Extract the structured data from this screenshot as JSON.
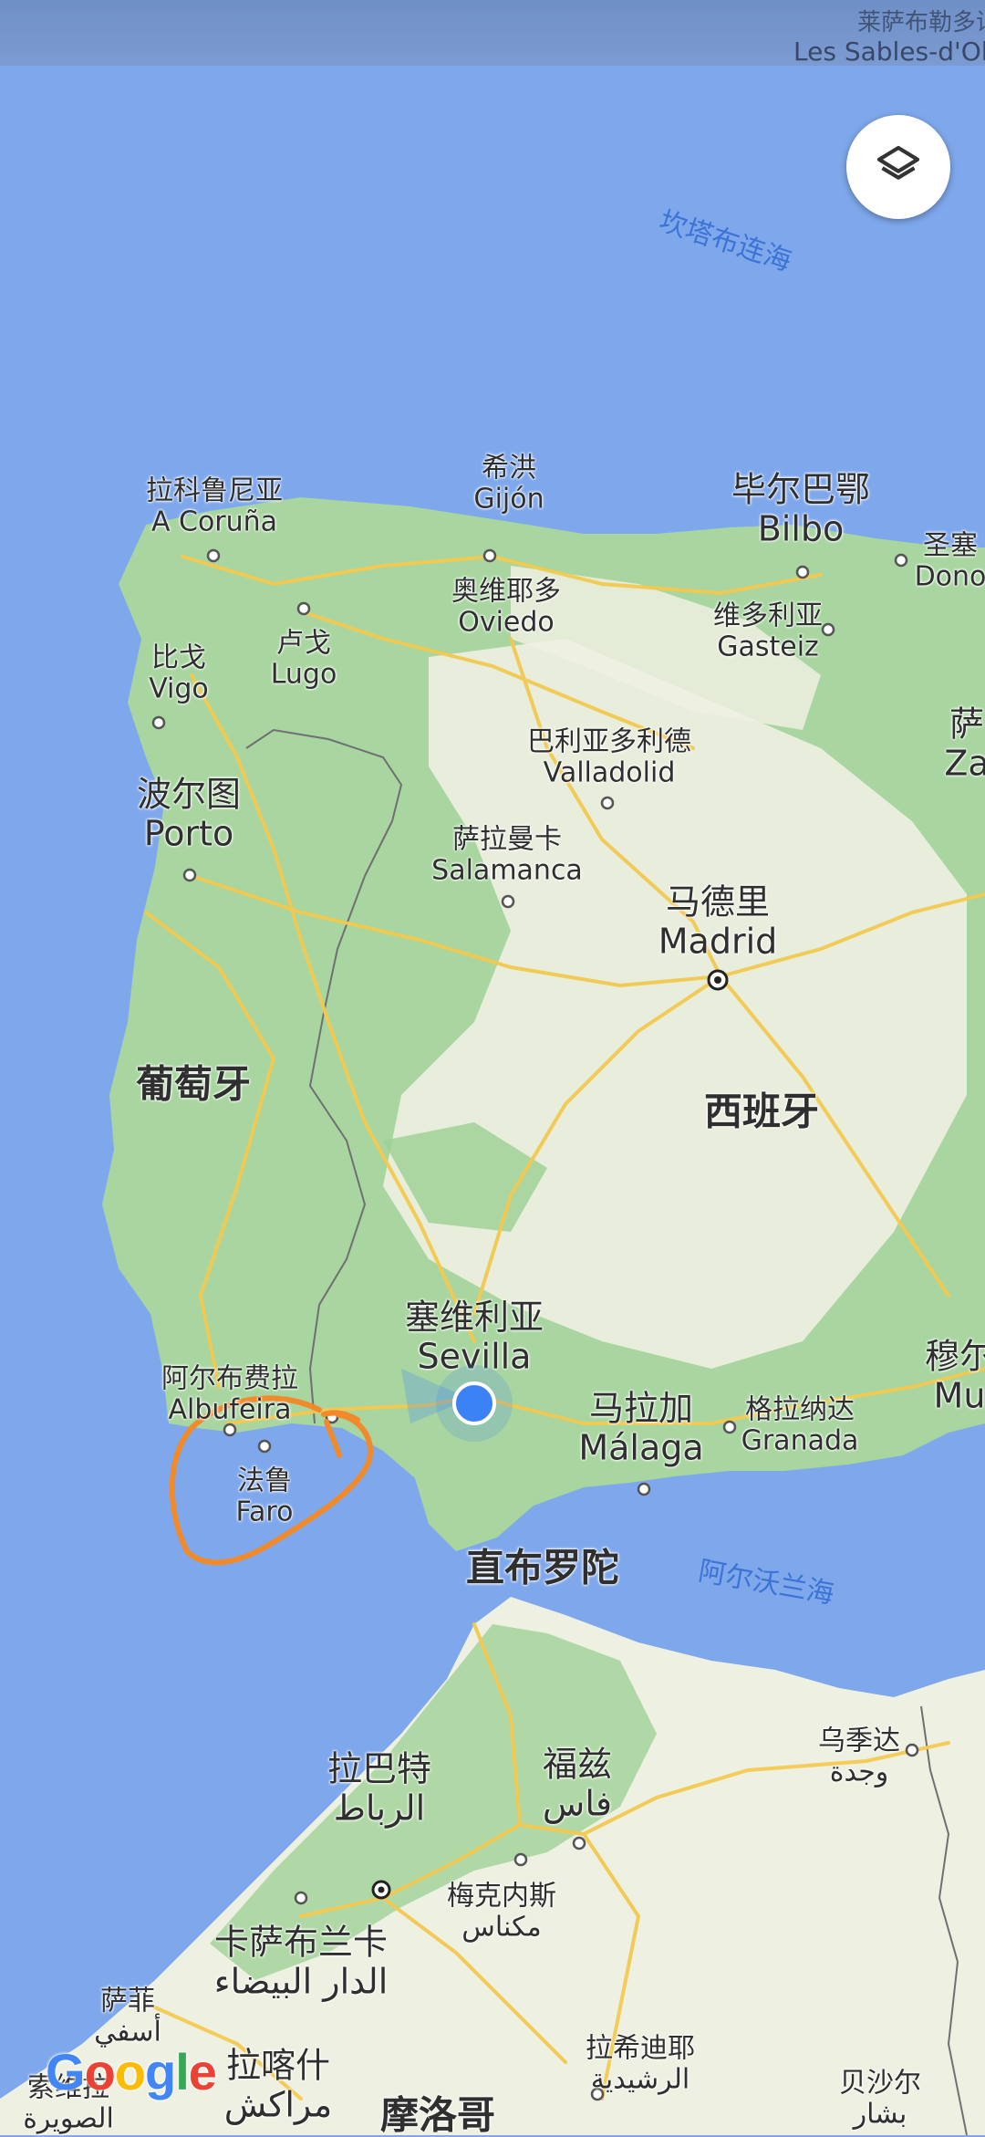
{
  "status_bar": {
    "partial_label": "Les Sables-d'Olo",
    "partial_label_zh": "莱萨布勒多讷"
  },
  "map": {
    "provider": "Google",
    "colors": {
      "sea": "#7fa8ec",
      "land": "#a8d5a0",
      "land_arid": "#f1efe4",
      "road": "#f3c94f",
      "annotation": "#f08a2a",
      "location": "#3b82f6"
    },
    "seas": [
      {
        "id": "cantabrian",
        "name": "坎塔布连海"
      },
      {
        "id": "alboran",
        "name": "阿尔沃兰海"
      }
    ],
    "countries": [
      {
        "id": "portugal",
        "name": "葡萄牙"
      },
      {
        "id": "spain",
        "name": "西班牙"
      },
      {
        "id": "morocco",
        "name": "摩洛哥"
      }
    ],
    "cities": [
      {
        "id": "coruna",
        "zh": "拉科鲁尼亚",
        "local": "A Coruña"
      },
      {
        "id": "gijon",
        "zh": "希洪",
        "local": "Gijón"
      },
      {
        "id": "bilbo",
        "zh": "毕尔巴鄂",
        "local": "Bilbo"
      },
      {
        "id": "donostia",
        "zh": "圣塞",
        "local": "Dono"
      },
      {
        "id": "oviedo",
        "zh": "奥维耶多",
        "local": "Oviedo"
      },
      {
        "id": "gasteiz",
        "zh": "维多利亚",
        "local": "Gasteiz"
      },
      {
        "id": "lugo",
        "zh": "卢戈",
        "local": "Lugo"
      },
      {
        "id": "vigo",
        "zh": "比戈",
        "local": "Vigo"
      },
      {
        "id": "zaragoza",
        "zh": "萨",
        "local": "Za"
      },
      {
        "id": "valladolid",
        "zh": "巴利亚多利德",
        "local": "Valladolid"
      },
      {
        "id": "porto",
        "zh": "波尔图",
        "local": "Porto"
      },
      {
        "id": "salamanca",
        "zh": "萨拉曼卡",
        "local": "Salamanca"
      },
      {
        "id": "madrid",
        "zh": "马德里",
        "local": "Madrid"
      },
      {
        "id": "sevilla",
        "zh": "塞维利亚",
        "local": "Sevilla"
      },
      {
        "id": "murcia",
        "zh": "穆尔",
        "local": "Mu"
      },
      {
        "id": "albufeira",
        "zh": "阿尔布费拉",
        "local": "Albufeira"
      },
      {
        "id": "malaga",
        "zh": "马拉加",
        "local": "Málaga"
      },
      {
        "id": "granada",
        "zh": "格拉纳达",
        "local": "Granada"
      },
      {
        "id": "faro",
        "zh": "法鲁",
        "local": "Faro"
      },
      {
        "id": "gibraltar",
        "zh": "直布罗陀",
        "local": ""
      },
      {
        "id": "oujda",
        "zh": "乌季达",
        "local": "وجدة"
      },
      {
        "id": "rabat",
        "zh": "拉巴特",
        "local": "الرباط"
      },
      {
        "id": "fes",
        "zh": "福兹",
        "local": "فاس"
      },
      {
        "id": "meknes",
        "zh": "梅克内斯",
        "local": "مكناس"
      },
      {
        "id": "casablanca",
        "zh": "卡萨布兰卡",
        "local": "الدار البيضاء"
      },
      {
        "id": "safi",
        "zh": "萨菲",
        "local": "أسفي"
      },
      {
        "id": "marrakesh",
        "zh": "拉喀什",
        "local": "مراكش"
      },
      {
        "id": "errachidia",
        "zh": "拉希迪耶",
        "local": "الرشيدية"
      },
      {
        "id": "bechar",
        "zh": "贝沙尔",
        "local": "بشار"
      },
      {
        "id": "laayoune",
        "zh": "索维拉",
        "local": "الصويرة"
      }
    ],
    "logo": "Google"
  },
  "controls": {
    "layers_icon": "layers-icon"
  }
}
